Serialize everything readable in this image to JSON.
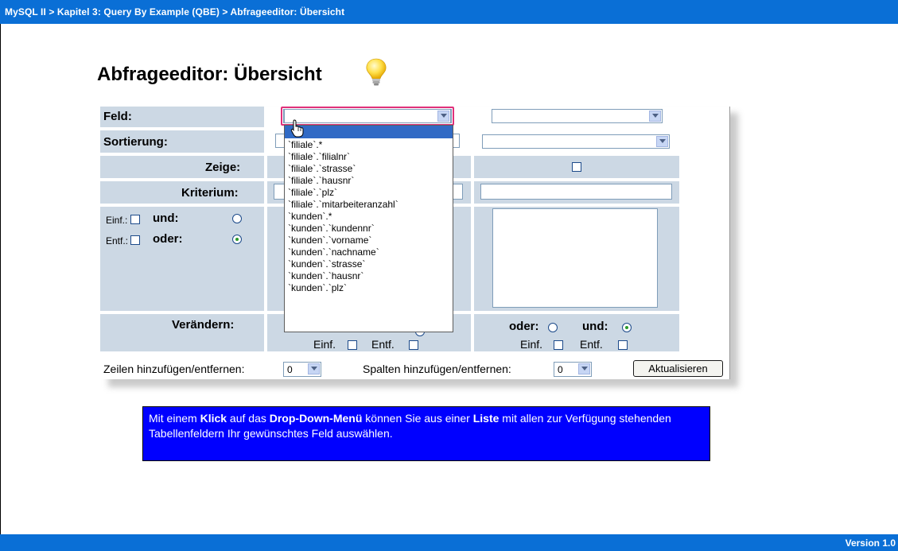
{
  "header": {
    "breadcrumb": "MySQL II > Kapitel 3: Query By Example (QBE) > Abfrageeditor: Übersicht"
  },
  "footer": {
    "version": "Version 1.0"
  },
  "page": {
    "title": "Abfrageeditor: Übersicht"
  },
  "qbe": {
    "labels": {
      "feld": "Feld:",
      "sortierung": "Sortierung:",
      "zeige": "Zeige:",
      "kriterium": "Kriterium:",
      "veraendern": "Verändern:"
    },
    "row_controls": {
      "einf": "Einf.:",
      "entf": "Entf.:",
      "und": "und:",
      "oder": "oder:"
    },
    "column_controls": {
      "oder": "oder:",
      "und": "und:",
      "einf": "Einf.",
      "entf": "Entf."
    },
    "footer": {
      "zeilen_label": "Zeilen hinzufügen/entfernen:",
      "zeilen_value": "0",
      "spalten_label": "Spalten hinzufügen/entfernen:",
      "spalten_value": "0",
      "update_button": "Aktualisieren"
    },
    "dropdown_items": [
      "`filiale`.*",
      "`filiale`.`filialnr`",
      "`filiale`.`strasse`",
      "`filiale`.`hausnr`",
      "`filiale`.`plz`",
      "`filiale`.`mitarbeiteranzahl`",
      "`kunden`.*",
      "`kunden`.`kundennr`",
      "`kunden`.`vorname`",
      "`kunden`.`nachname`",
      "`kunden`.`strasse`",
      "`kunden`.`hausnr`",
      "`kunden`.`plz`"
    ]
  },
  "info": {
    "part1": "Mit einem ",
    "bold1": "Klick",
    "part2": " auf das ",
    "bold2": "Drop-Down-Menü",
    "part3": " können Sie aus einer ",
    "bold3": "Liste",
    "part4": " mit allen zur Verfügung stehenden Tabellenfeldern Ihr gewünschtes Feld auswählen."
  },
  "colors": {
    "bar_blue": "#0a6fd6",
    "row_tint": "#ccd8e4",
    "focus_pink": "#e0307a",
    "info_blue": "#0000ff",
    "highlight": "#316ac5"
  },
  "icons": {
    "bulb": "lightbulb-icon",
    "cursor": "hand-pointer-icon"
  }
}
